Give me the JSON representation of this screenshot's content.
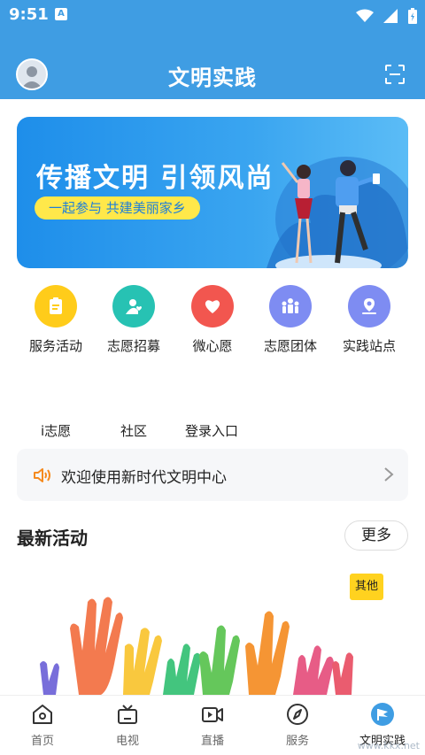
{
  "status": {
    "time": "9:51",
    "notification_badge": "A"
  },
  "header": {
    "title": "文明实践",
    "avatar_icon": "avatar-icon",
    "scan_icon": "scan-icon"
  },
  "banner": {
    "headline": "传播文明 引领风尚",
    "slogan": "一起参与 共建美丽家乡"
  },
  "quick_actions": [
    {
      "label": "服务活动",
      "icon": "clipboard-icon",
      "color": "#ffcc1a"
    },
    {
      "label": "志愿招募",
      "icon": "person-heart-icon",
      "color": "#27c2b3"
    },
    {
      "label": "微心愿",
      "icon": "heart-icon",
      "color": "#f2564f"
    },
    {
      "label": "志愿团体",
      "icon": "group-icon",
      "color": "#7e8cf2"
    },
    {
      "label": "实践站点",
      "icon": "location-icon",
      "color": "#7e8cf2"
    }
  ],
  "links": [
    "i志愿",
    "社区",
    "登录入口"
  ],
  "notice": {
    "text": "欢迎使用新时代文明中心"
  },
  "latest": {
    "title": "最新活动",
    "more_label": "更多",
    "tag": "其他"
  },
  "tabs": [
    {
      "label": "首页",
      "icon": "home-icon"
    },
    {
      "label": "电视",
      "icon": "tv-icon"
    },
    {
      "label": "直播",
      "icon": "live-icon"
    },
    {
      "label": "服务",
      "icon": "compass-icon"
    },
    {
      "label": "文明实践",
      "icon": "flag-icon",
      "active": true
    }
  ],
  "watermark": "www.kkx.net",
  "colors": {
    "primary": "#3f9de3",
    "accent_yellow": "#ffe84a"
  }
}
